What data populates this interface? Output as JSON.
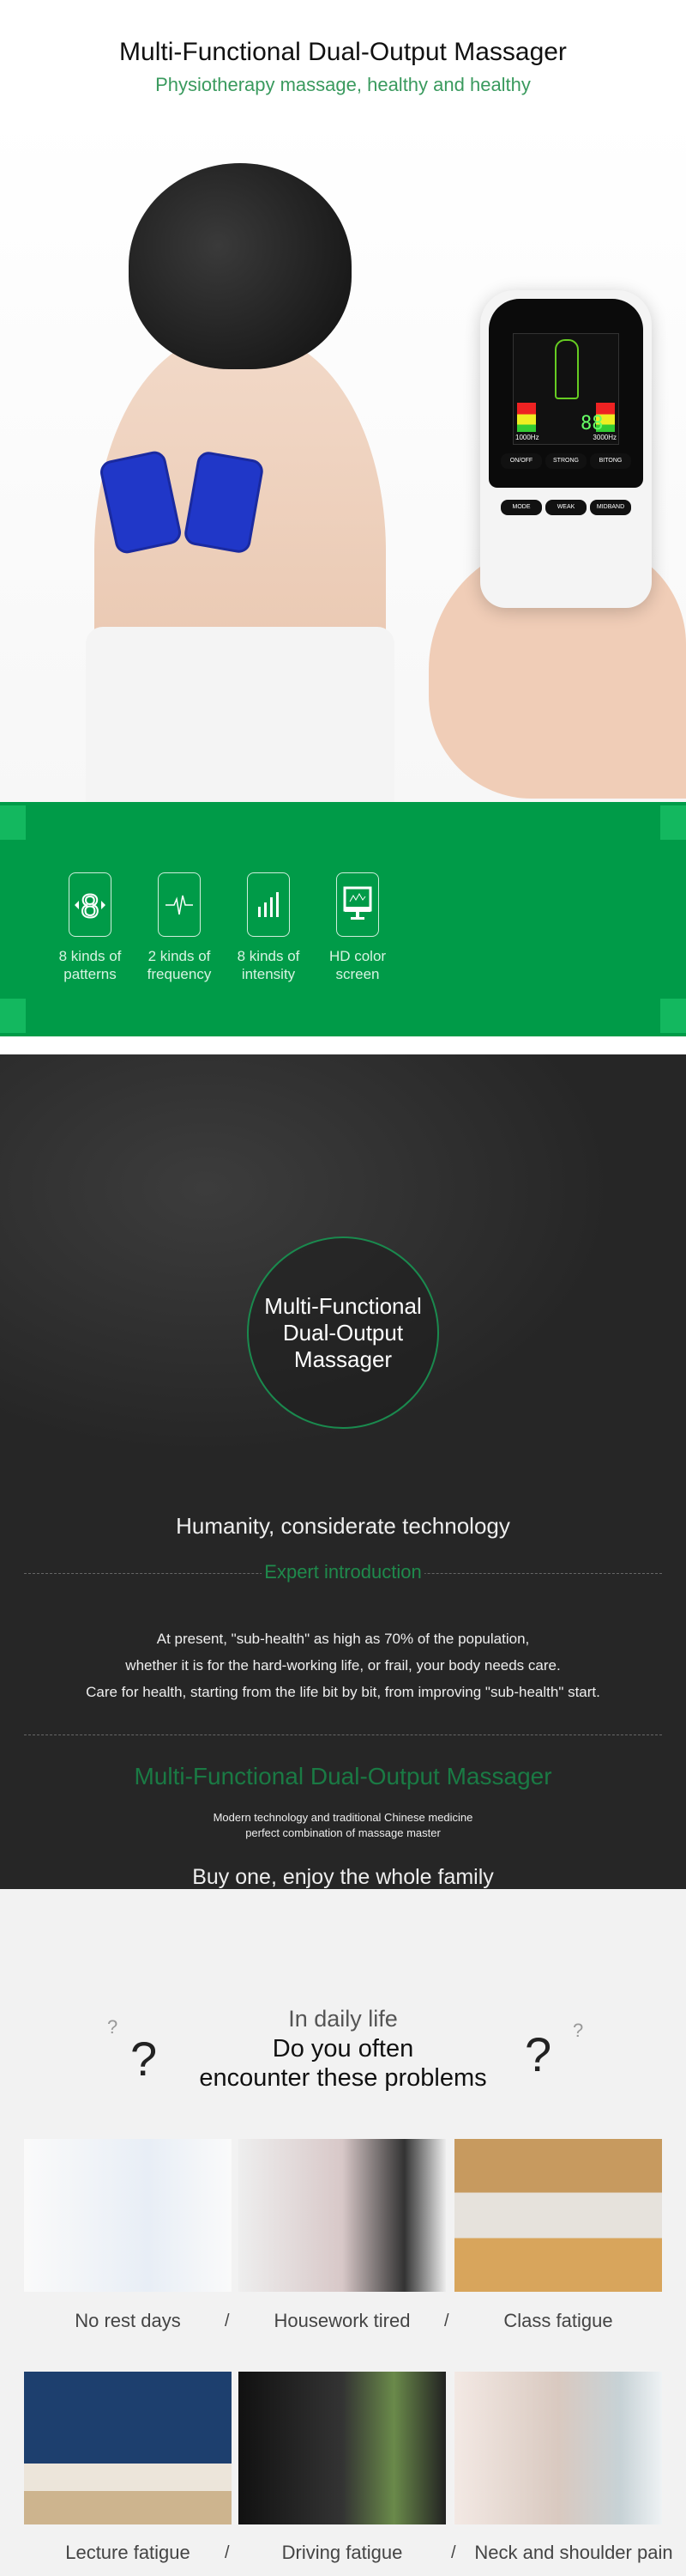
{
  "header": {
    "title": "Multi-Functional Dual-Output Massager",
    "subtitle": "Physiotherapy massage, healthy and healthy"
  },
  "device": {
    "display": "88",
    "freq_left": "1000Hz",
    "freq_right": "3000Hz",
    "buttons": [
      "ON/OFF",
      "STRONG",
      "BITONG",
      "MODE",
      "WEAK",
      "MIDBAND"
    ]
  },
  "features": [
    {
      "icon": "digit-8-icon",
      "line1": "8 kinds of",
      "line2": "patterns"
    },
    {
      "icon": "pulse-wave-icon",
      "line1": "2 kinds of",
      "line2": "frequency"
    },
    {
      "icon": "signal-bars-icon",
      "line1": "8 kinds of",
      "line2": "intensity"
    },
    {
      "icon": "monitor-icon",
      "line1": "HD color",
      "line2": "screen"
    }
  ],
  "intro": {
    "circle_lines": [
      "Multi-Functional",
      "Dual-Output",
      "Massager"
    ],
    "tagline": "Humanity, considerate technology",
    "section_label": "Expert introduction",
    "paragraph": [
      "At present, \"sub-health\" as high as 70% of the population,",
      "whether it is for the hard-working life, or frail, your body needs care.",
      "Care for health, starting from the life bit by bit, from improving \"sub-health\" start."
    ],
    "product_title": "Multi-Functional Dual-Output Massager",
    "product_desc": [
      "Modern technology and traditional Chinese medicine",
      "perfect combination of massage master"
    ],
    "slogan": "Buy one, enjoy the whole family"
  },
  "problems": {
    "kicker": "In daily life",
    "heading_line1": "Do you often",
    "heading_line2": "encounter these problems",
    "items": [
      "No rest days",
      "Housework tired",
      "Class fatigue",
      "Lecture fatigue",
      "Driving fatigue",
      "Neck and shoulder pain"
    ],
    "separator": "/"
  },
  "colors": {
    "accent_green": "#009b48",
    "text_green": "#3a9a5e",
    "dark_bg": "#262626",
    "light_bg": "#f2f2f2"
  }
}
